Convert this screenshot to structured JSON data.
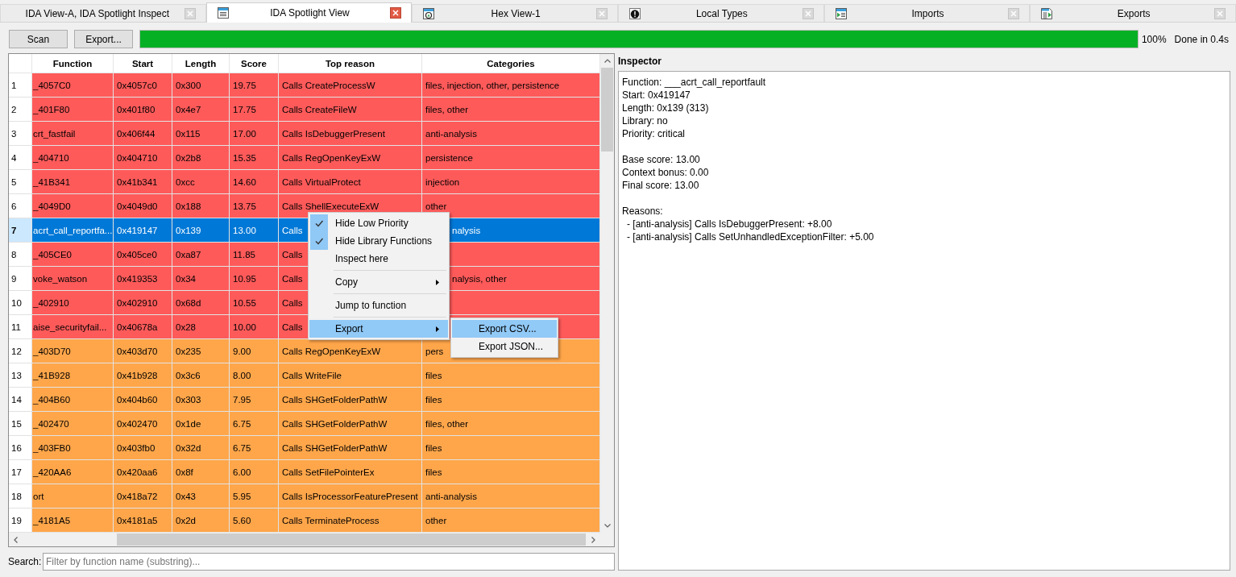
{
  "tabs": [
    {
      "label": "IDA View-A, IDA Spotlight Inspect",
      "kind": "plain",
      "selected": false
    },
    {
      "label": "IDA Spotlight View",
      "kind": "list",
      "selected": true
    },
    {
      "label": "Hex View-1",
      "kind": "hex",
      "selected": false
    },
    {
      "label": "Local Types",
      "kind": "types",
      "selected": false
    },
    {
      "label": "Imports",
      "kind": "imports",
      "selected": false
    },
    {
      "label": "Exports",
      "kind": "exports",
      "selected": false
    }
  ],
  "toolbar": {
    "buttons": [
      "Scan",
      "Export..."
    ],
    "progress": {
      "level": 1,
      "percent": "100%",
      "status": "Done in 0.4s"
    }
  },
  "table": {
    "columns": [
      "Function",
      "Start",
      "Length",
      "Score",
      "Top reason",
      "Categories"
    ],
    "rows": [
      {
        "number": "1",
        "function": "_4057C0",
        "start": "0x4057c0",
        "length": "0x300",
        "score": "19.75",
        "top_reason": "Calls CreateProcessW",
        "categories": "files, injection, other, persistence",
        "color": "#ff5a5a",
        "selected": false
      },
      {
        "number": "2",
        "function": "_401F80",
        "start": "0x401f80",
        "length": "0x4e7",
        "score": "17.75",
        "top_reason": "Calls CreateFileW",
        "categories": "files, other",
        "color": "#ff5a5a",
        "selected": false
      },
      {
        "number": "3",
        "function": "crt_fastfail",
        "start": "0x406f44",
        "length": "0x115",
        "score": "17.00",
        "top_reason": "Calls IsDebuggerPresent",
        "categories": "anti-analysis",
        "color": "#ff5a5a",
        "selected": false
      },
      {
        "number": "4",
        "function": "_404710",
        "start": "0x404710",
        "length": "0x2b8",
        "score": "15.35",
        "top_reason": "Calls RegOpenKeyExW",
        "categories": "persistence",
        "color": "#ff5a5a",
        "selected": false
      },
      {
        "number": "5",
        "function": "_41B341",
        "start": "0x41b341",
        "length": "0xcc",
        "score": "14.60",
        "top_reason": "Calls VirtualProtect",
        "categories": "injection",
        "color": "#ff5a5a",
        "selected": false
      },
      {
        "number": "6",
        "function": "_4049D0",
        "start": "0x4049d0",
        "length": "0x188",
        "score": "13.75",
        "top_reason": "Calls ShellExecuteExW",
        "categories": "other",
        "color": "#ff5a5a",
        "selected": false
      },
      {
        "number": "7",
        "function": "acrt_call_reportfa...",
        "start": "0x419147",
        "length": "0x139",
        "score": "13.00",
        "top_reason": "Calls",
        "categories": "nalysis",
        "selected": true
      },
      {
        "number": "8",
        "function": "_405CE0",
        "start": "0x405ce0",
        "length": "0xa87",
        "score": "11.85",
        "top_reason": "Calls",
        "color": "#ff5a5a",
        "selected": false
      },
      {
        "number": "9",
        "function": "voke_watson",
        "start": "0x419353",
        "length": "0x34",
        "score": "10.95",
        "top_reason": "Calls",
        "categories": "nalysis, other",
        "color": "#ff5a5a",
        "selected": false
      },
      {
        "number": "10",
        "function": "_402910",
        "start": "0x402910",
        "length": "0x68d",
        "score": "10.55",
        "top_reason": "Calls",
        "color": "#ff5a5a",
        "selected": false
      },
      {
        "number": "11",
        "function": "aise_securityfail...",
        "start": "0x40678a",
        "length": "0x28",
        "score": "10.00",
        "top_reason": "Calls",
        "color": "#ff5a5a",
        "selected": false
      },
      {
        "number": "12",
        "function": "_403D70",
        "start": "0x403d70",
        "length": "0x235",
        "score": "9.00",
        "top_reason": "Calls RegOpenKeyExW",
        "categories": "pers",
        "color": "#ffa64a",
        "selected": false
      },
      {
        "number": "13",
        "function": "_41B928",
        "start": "0x41b928",
        "length": "0x3c6",
        "score": "8.00",
        "top_reason": "Calls WriteFile",
        "categories": "files",
        "color": "#ffa64a",
        "selected": false
      },
      {
        "number": "14",
        "function": "_404B60",
        "start": "0x404b60",
        "length": "0x303",
        "score": "7.95",
        "top_reason": "Calls SHGetFolderPathW",
        "categories": "files",
        "color": "#ffa64a",
        "selected": false
      },
      {
        "number": "15",
        "function": "_402470",
        "start": "0x402470",
        "length": "0x1de",
        "score": "6.75",
        "top_reason": "Calls SHGetFolderPathW",
        "categories": "files, other",
        "color": "#ffa64a",
        "selected": false
      },
      {
        "number": "16",
        "function": "_403FB0",
        "start": "0x403fb0",
        "length": "0x32d",
        "score": "6.75",
        "top_reason": "Calls SHGetFolderPathW",
        "categories": "files",
        "color": "#ffa64a",
        "selected": false
      },
      {
        "number": "17",
        "function": "_420AA6",
        "start": "0x420aa6",
        "length": "0x8f",
        "score": "6.00",
        "top_reason": "Calls SetFilePointerEx",
        "categories": "files",
        "color": "#ffa64a",
        "selected": false
      },
      {
        "number": "18",
        "function": "ort",
        "start": "0x418a72",
        "length": "0x43",
        "score": "5.95",
        "top_reason": "Calls IsProcessorFeaturePresent",
        "categories": "anti-analysis",
        "color": "#ffa64a",
        "selected": false
      },
      {
        "number": "19",
        "function": "_4181A5",
        "start": "0x4181a5",
        "length": "0x2d",
        "score": "5.60",
        "top_reason": "Calls TerminateProcess",
        "categories": "other",
        "color": "#ffa64a",
        "selected": false
      }
    ]
  },
  "context_menu": {
    "groups": [
      [
        {
          "label": "Hide Low Priority",
          "checked": true,
          "has_submenu": false,
          "selected": false
        },
        {
          "label": "Hide Library Functions",
          "checked": true,
          "has_submenu": false,
          "selected": false
        },
        {
          "label": "Inspect here",
          "checked": false,
          "has_submenu": false,
          "selected": false
        }
      ],
      [
        {
          "label": "Copy",
          "checked": false,
          "has_submenu": true,
          "selected": false
        }
      ],
      [
        {
          "label": "Jump to function",
          "checked": false,
          "has_submenu": false,
          "selected": false
        }
      ],
      [
        {
          "label": "Export",
          "checked": false,
          "has_submenu": true,
          "selected": true,
          "submenu": [
            {
              "label": "Export CSV...",
              "selected": true
            },
            {
              "label": "Export JSON...",
              "selected": false
            }
          ]
        }
      ]
    ]
  },
  "search": {
    "label": "Search:",
    "placeholder": "Filter by function name (substring)..."
  },
  "inspector": {
    "title": "Inspector",
    "sections": [
      {
        "lines": [
          "Function: ___acrt_call_reportfault",
          "Start: 0x419147",
          "Length: 0x139 (313)",
          "Library: no",
          "Priority: critical"
        ]
      },
      {
        "lines": [
          "Base score: 13.00",
          "Context bonus: 0.00",
          "Final score: 13.00"
        ]
      },
      {
        "heading": "Reasons:",
        "items": [
          "- [anti-analysis] Calls IsDebuggerPresent: +8.00",
          "- [anti-analysis] Calls SetUnhandledExceptionFilter: +5.00"
        ]
      }
    ]
  }
}
